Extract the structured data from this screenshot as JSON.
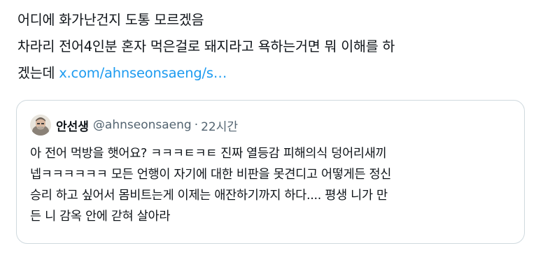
{
  "tweet": {
    "lines": [
      "어디에 화가난건지 도통 모르겠음",
      "차라리 전어4인분 혼자 먹은걸로 돼지라고 욕하는거면 뭐 이해를 하",
      "겠는데 "
    ],
    "link_text": "x.com/ahnseonsaeng/s…"
  },
  "quote": {
    "author_name": "안선생",
    "author_handle": "@ahnseonsaeng",
    "separator": "·",
    "timestamp": "22시간",
    "lines": [
      "아 전어 먹방을 햇어요? ㅋㅋㅋㅌㅋㅌ 진짜 열등감 피해의식 덩어리새끼",
      "넵ㅋㅋㅋㅋㅋㅋ 모든 언행이 자기에 대한 비판을 못견디고 어떻게든 정신",
      "승리 하고 싶어서 몸비트는게 이제는 애잔하기까지 하다.... 평생 니가 만",
      "든 니 감옥 안에 갇혀 살아라"
    ]
  },
  "colors": {
    "text": "#0f1419",
    "link": "#1d9bf0",
    "muted": "#536471",
    "border": "#cfd9de"
  },
  "icons": {
    "avatar": "avatar-image"
  }
}
